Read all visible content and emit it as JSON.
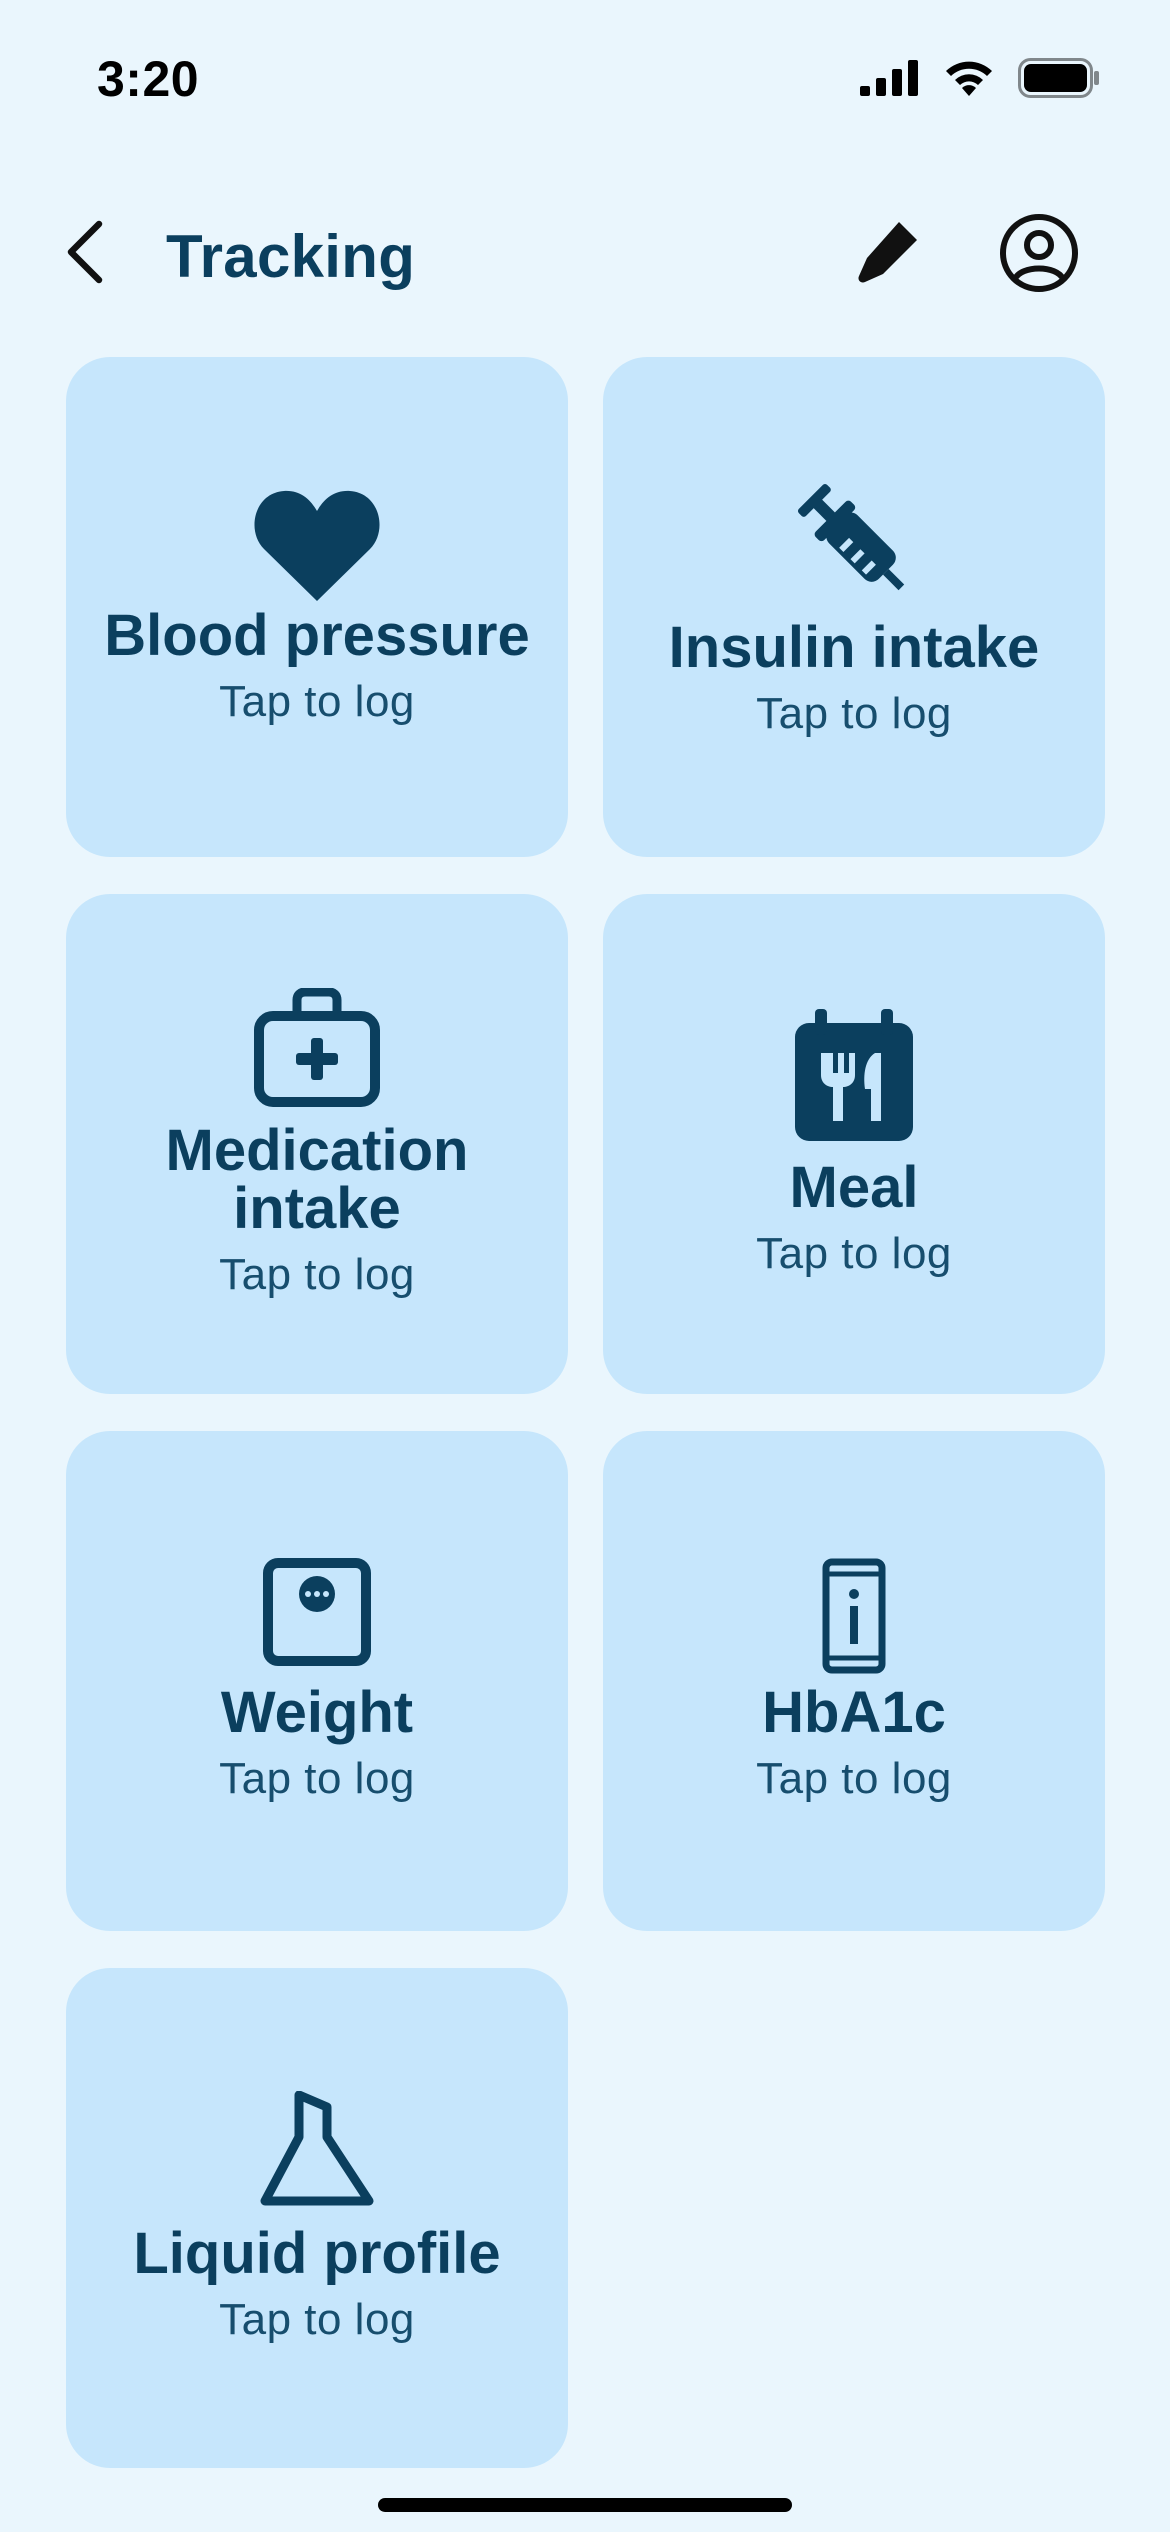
{
  "status_bar": {
    "time": "3:20",
    "icons": [
      "cellular-signal-icon",
      "wifi-icon",
      "battery-icon"
    ]
  },
  "header": {
    "title": "Tracking",
    "back_icon": "chevron-left-icon",
    "edit_icon": "pencil-icon",
    "profile_icon": "user-circle-icon"
  },
  "tiles": [
    {
      "title": "Blood pressure",
      "subtitle": "Tap to log",
      "icon": "heart-icon"
    },
    {
      "title": "Insulin intake",
      "subtitle": "Tap to log",
      "icon": "syringe-icon"
    },
    {
      "title": "Medication intake",
      "subtitle": "Tap to log",
      "icon": "medical-kit-icon"
    },
    {
      "title": "Meal",
      "subtitle": "Tap to log",
      "icon": "meal-calendar-icon"
    },
    {
      "title": "Weight",
      "subtitle": "Tap to log",
      "icon": "scale-icon"
    },
    {
      "title": "HbA1c",
      "subtitle": "Tap to log",
      "icon": "phone-info-icon"
    },
    {
      "title": "Liquid profile",
      "subtitle": "Tap to log",
      "icon": "flask-icon"
    }
  ],
  "colors": {
    "background": "#EAF6FD",
    "tile": "#C6E6FC",
    "accent": "#0B3F5E"
  }
}
